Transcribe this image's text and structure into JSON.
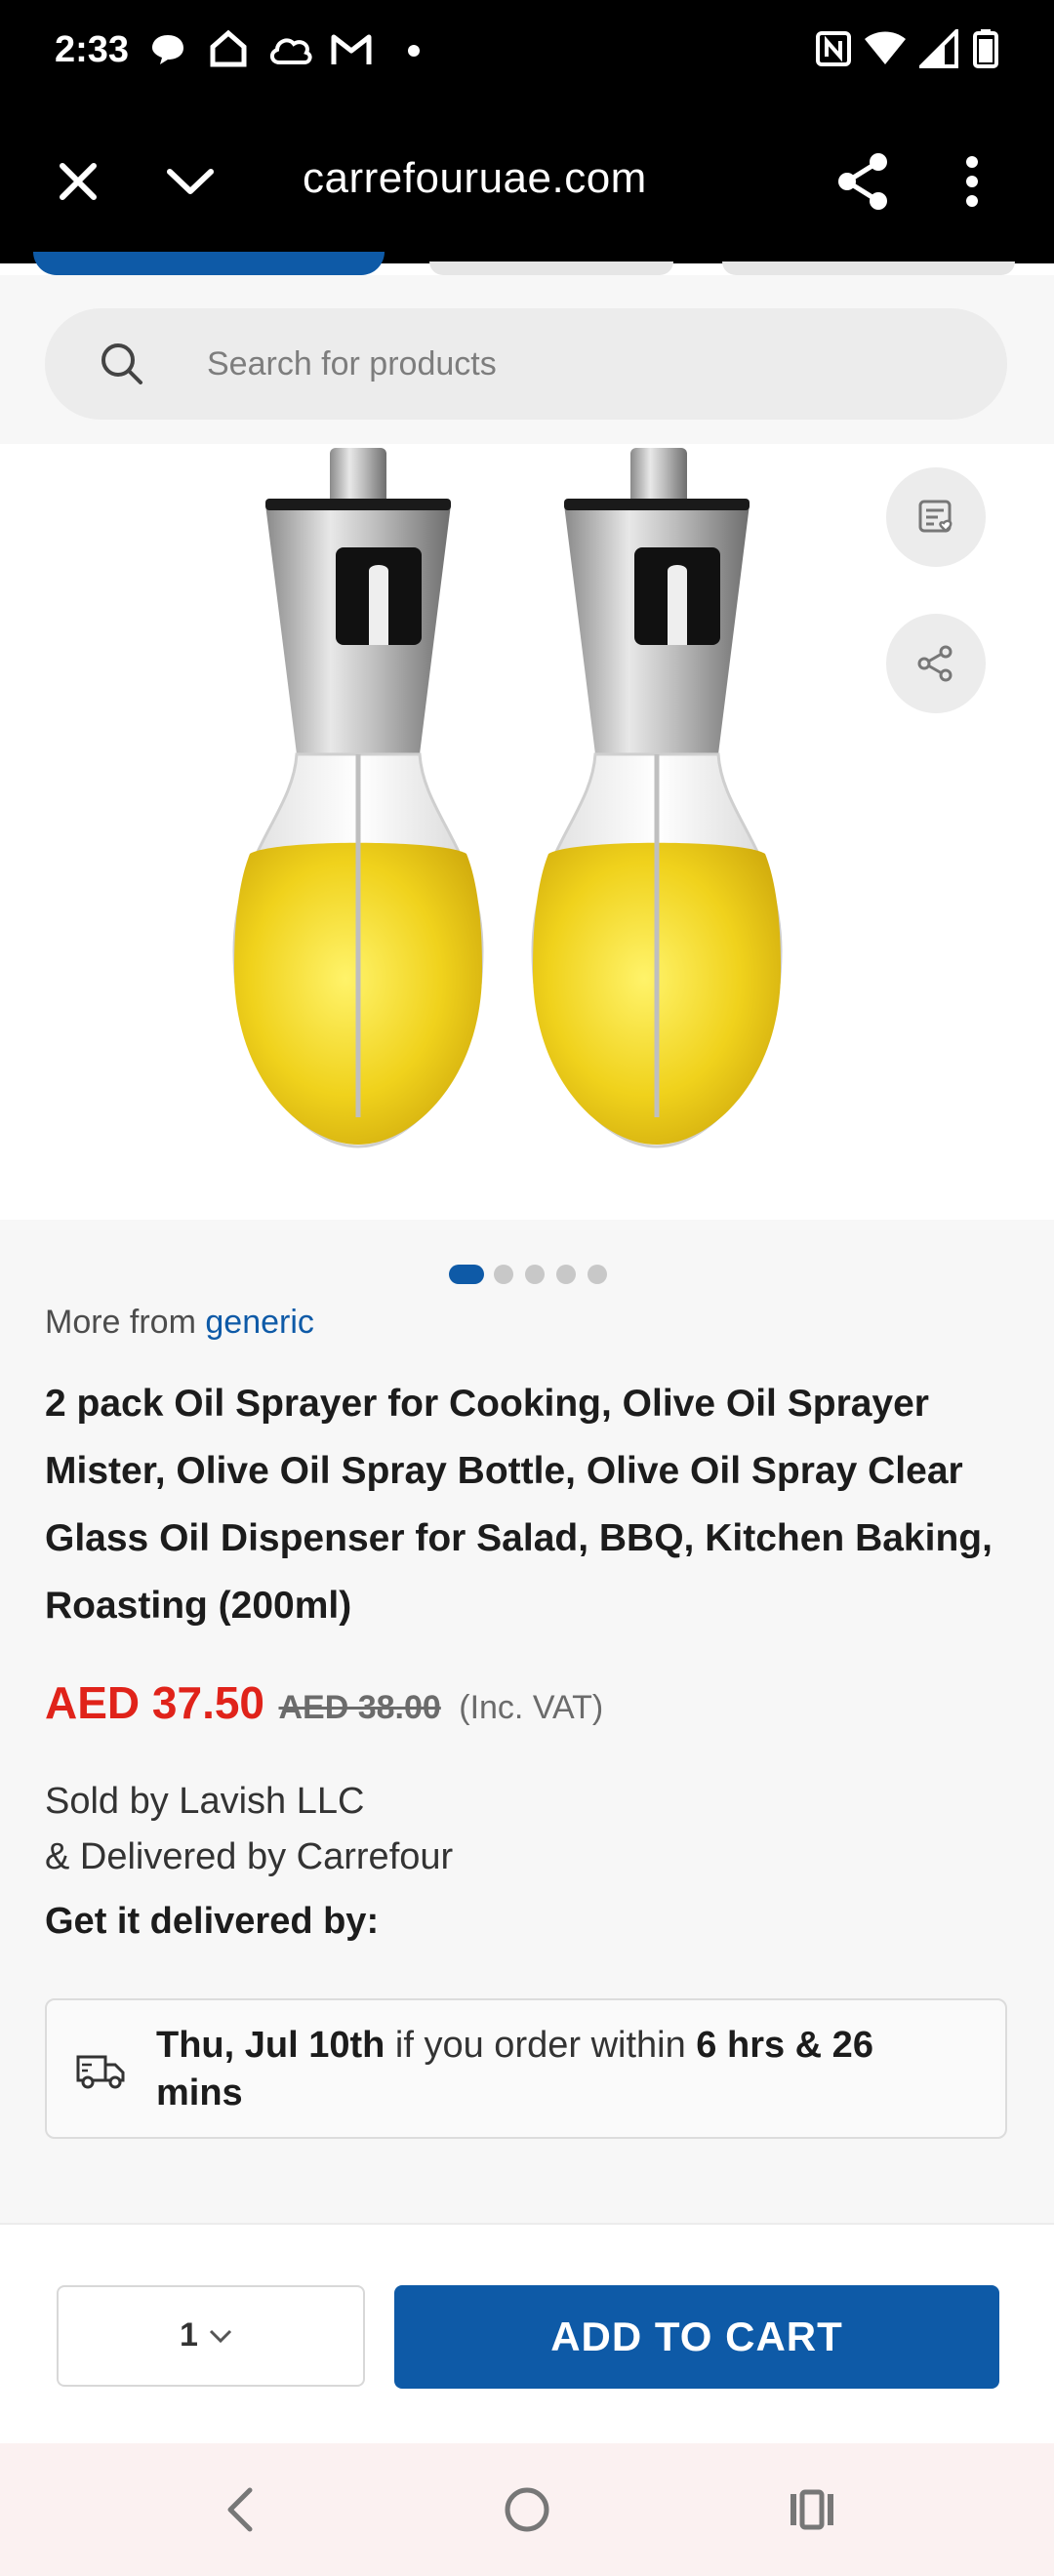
{
  "status_bar": {
    "time": "2:33",
    "left_icons": [
      "chat-bubble-icon",
      "home-icon",
      "cloud-icon",
      "gmail-icon",
      "dot-icon"
    ],
    "right_icons": [
      "nfc-icon",
      "wifi-icon",
      "signal-icon",
      "battery-icon"
    ]
  },
  "browser": {
    "url": "carrefouruae.com",
    "icons": [
      "close-icon",
      "chevron-down-icon",
      "share-icon",
      "more-vert-icon"
    ]
  },
  "search": {
    "placeholder": "Search for products"
  },
  "gallery": {
    "image_count": 5,
    "active_index": 0,
    "action_icons": [
      "compare-list-icon",
      "share-icon"
    ]
  },
  "product": {
    "more_from_label": "More from",
    "brand": "generic",
    "title": "2 pack Oil Sprayer for Cooking, Olive Oil Sprayer Mister, Olive Oil Spray Bottle, Olive Oil Spray Clear Glass Oil Dispenser for Salad, BBQ, Kitchen Baking, Roasting (200ml)",
    "price_now": "AED 37.50",
    "price_old": "AED 38.00",
    "price_vat": "(Inc. VAT)",
    "sold_by": "Sold by Lavish LLC",
    "delivered_by": "& Delivered by Carrefour",
    "delivery_label": "Get it delivered by:",
    "delivery_date": "Thu, Jul 10th",
    "delivery_mid": "if you order within",
    "delivery_time": "6 hrs & 26 mins"
  },
  "cart": {
    "quantity": "1",
    "add_label": "ADD TO CART"
  },
  "colors": {
    "brand_blue": "#0e5aa7",
    "price_red": "#e0231a"
  }
}
